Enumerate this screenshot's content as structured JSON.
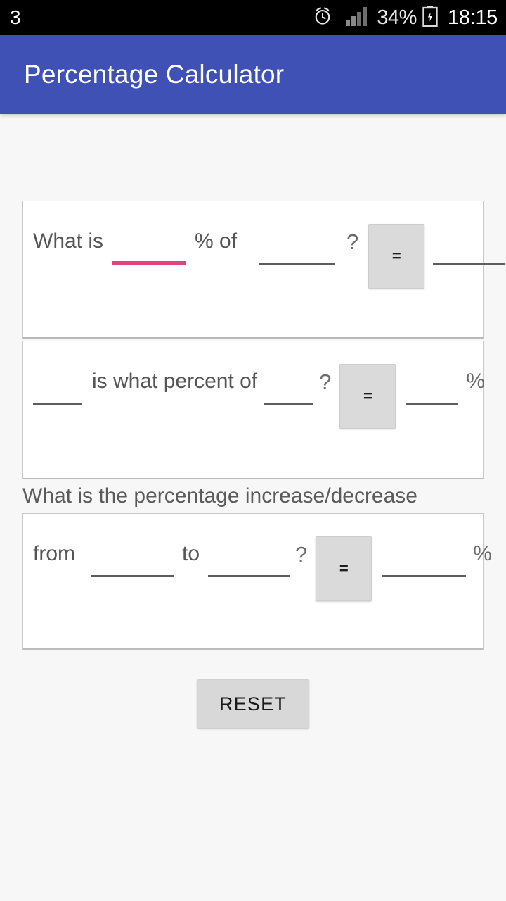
{
  "status_bar": {
    "left_text": "3",
    "alarm_icon": "alarm-clock-icon",
    "signal_icon": "signal-bars-icon",
    "battery_percent": "34%",
    "battery_icon": "battery-charging-icon",
    "clock": "18:15"
  },
  "app_bar": {
    "title": "Percentage Calculator",
    "background_color": "#3f51b5"
  },
  "theme": {
    "accent_color": "#e0457b",
    "page_background": "#f7f7f7",
    "card_background": "#ffffff",
    "button_background": "#dadada"
  },
  "calculators": {
    "card1": {
      "prefix_label": "What is",
      "input_percent": {
        "value": "",
        "placeholder": "",
        "focused": true
      },
      "mid_label": "% of",
      "input_base": {
        "value": "",
        "placeholder": ""
      },
      "question_mark": "?",
      "equals_label": "=",
      "result": {
        "value": "",
        "placeholder": ""
      }
    },
    "card2": {
      "input_part": {
        "value": "",
        "placeholder": ""
      },
      "mid_label": "is what percent of",
      "input_whole": {
        "value": "",
        "placeholder": ""
      },
      "question_mark": "?",
      "equals_label": "=",
      "result": {
        "value": "",
        "placeholder": ""
      },
      "suffix_label": "%"
    },
    "section_label": "What is the percentage increase/decrease",
    "card3": {
      "from_label": "from",
      "input_from": {
        "value": "",
        "placeholder": ""
      },
      "to_label": "to",
      "input_to": {
        "value": "",
        "placeholder": ""
      },
      "question_mark": "?",
      "equals_label": "=",
      "result": {
        "value": "",
        "placeholder": ""
      },
      "suffix_label": "%"
    }
  },
  "actions": {
    "reset_label": "RESET"
  }
}
